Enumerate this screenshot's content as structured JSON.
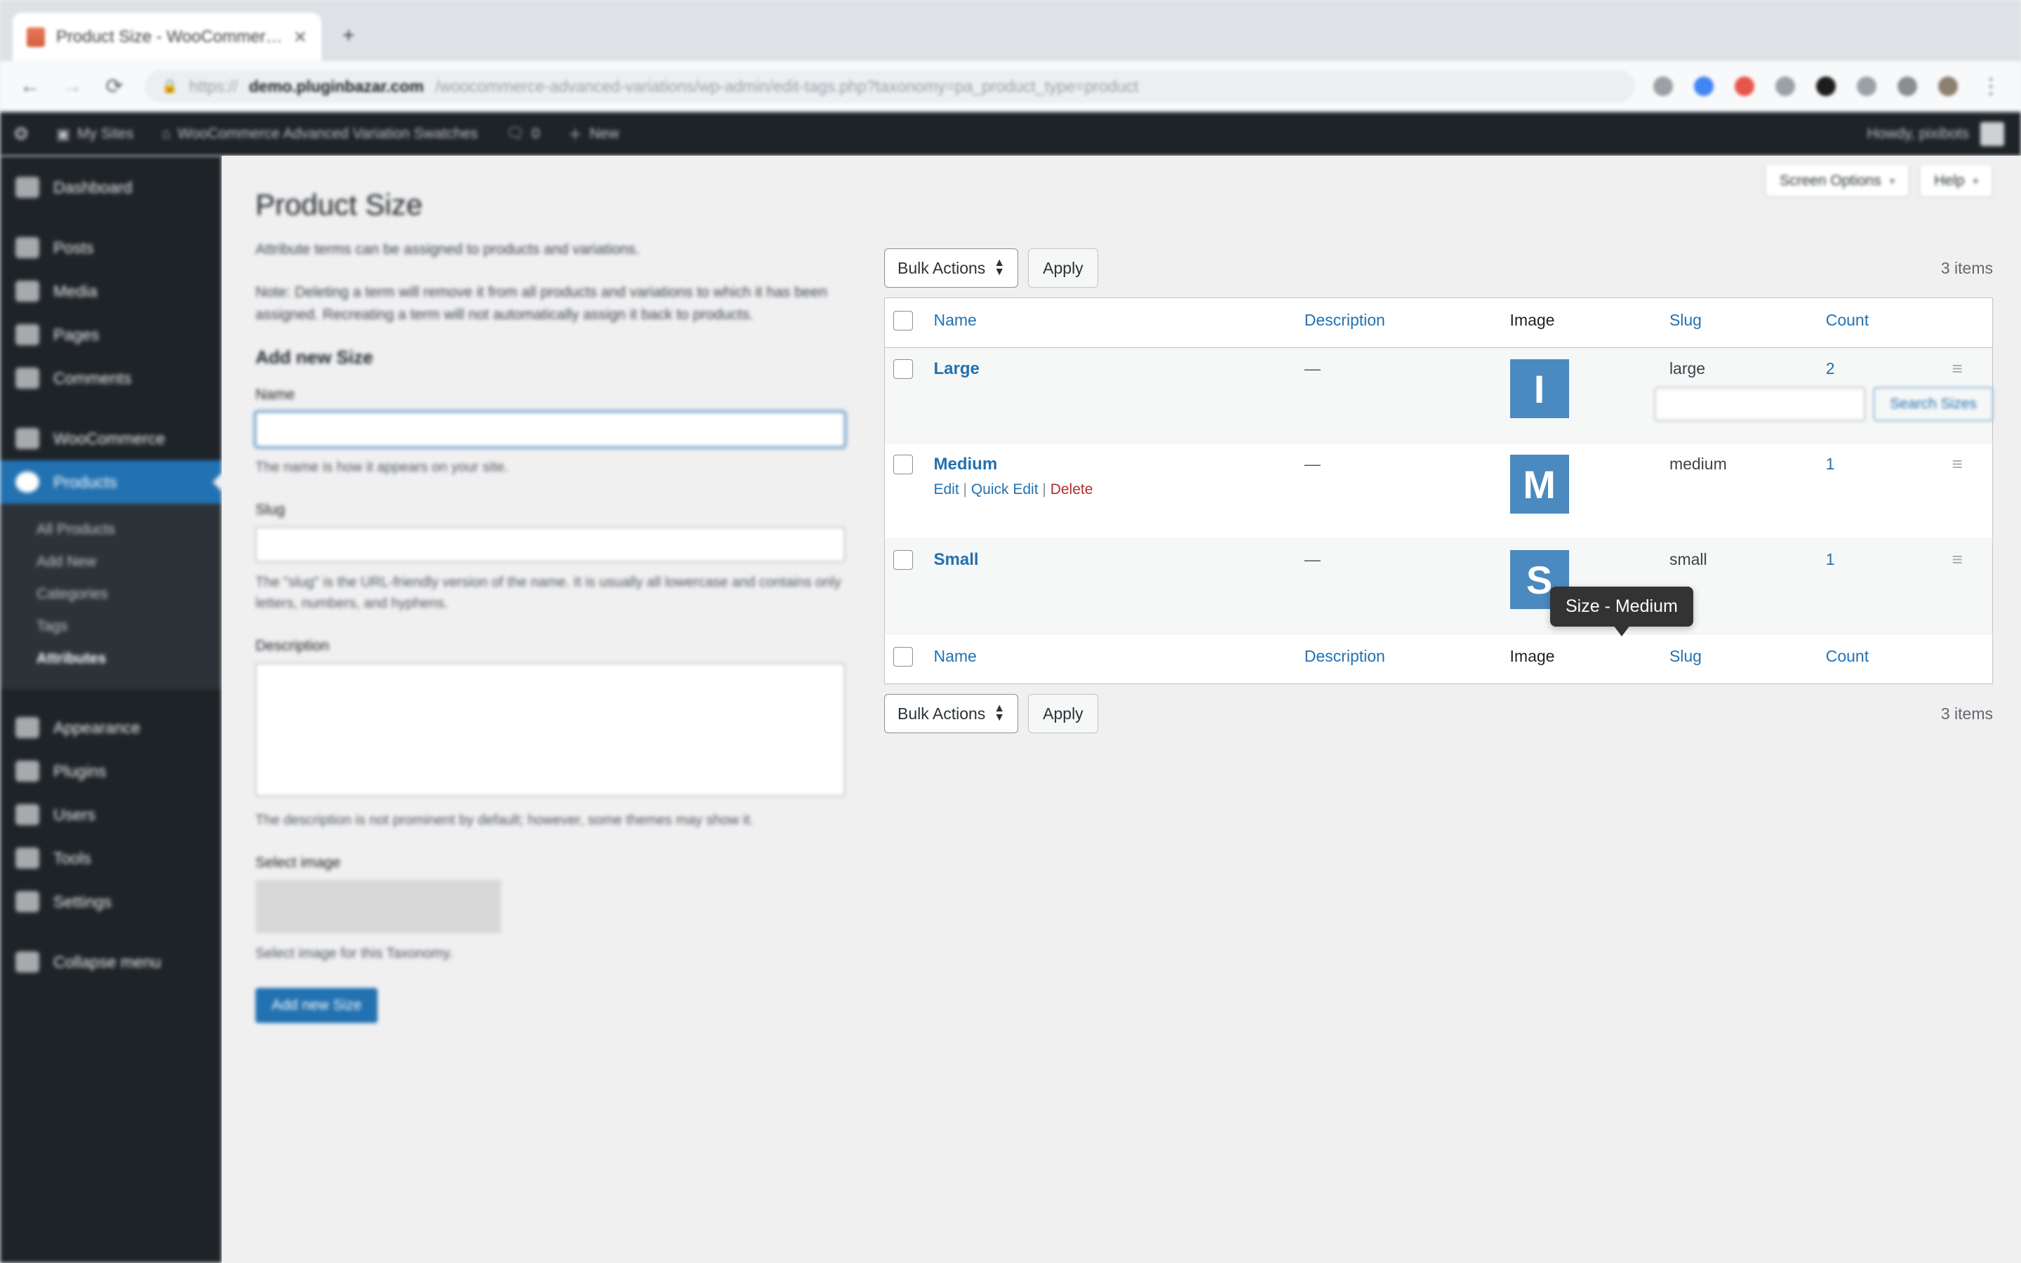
{
  "browser": {
    "tab": {
      "title": "Product Size - WooCommer…",
      "close": "✕",
      "favicon": "wordpress-favicon"
    },
    "new_tab": "+",
    "nav": {
      "back": "←",
      "forward": "→",
      "reload": "⟳"
    },
    "url": {
      "lock": "🔒",
      "scheme": "https://",
      "host": "demo.pluginbazar.com",
      "path": "/woocommerce-advanced-variations/wp-admin/edit-tags.php?taxonomy=pa_product_type=product"
    },
    "extensions": [
      "ext-gray",
      "ext-blue",
      "ext-red",
      "ext-gray2",
      "ext-dark",
      "ext-gray3",
      "ext-gray4",
      "ext-avatar"
    ],
    "menu": "⋮"
  },
  "adminbar": {
    "logo": "wordpress-logo",
    "my_sites": "My Sites",
    "site_name": "WooCommerce Advanced Variation Swatches",
    "comments_count": "0",
    "new": "New",
    "howdy": "Howdy, pixibots"
  },
  "sidebar": {
    "items": [
      {
        "label": "Dashboard",
        "icon": "dashboard-icon",
        "sep": false
      },
      {
        "label": "Posts",
        "icon": "posts-icon",
        "sep": true
      },
      {
        "label": "Media",
        "icon": "media-icon",
        "sep": false
      },
      {
        "label": "Pages",
        "icon": "pages-icon",
        "sep": false
      },
      {
        "label": "Comments",
        "icon": "comments-icon",
        "sep": false
      },
      {
        "label": "WooCommerce",
        "icon": "woocommerce-icon",
        "sep": true
      },
      {
        "label": "Products",
        "icon": "products-icon",
        "sep": false,
        "current": true
      }
    ],
    "submenu": [
      {
        "label": "All Products",
        "current": false
      },
      {
        "label": "Add New",
        "current": false
      },
      {
        "label": "Categories",
        "current": false
      },
      {
        "label": "Tags",
        "current": false
      },
      {
        "label": "Attributes",
        "current": true
      }
    ],
    "items_after": [
      {
        "label": "Appearance",
        "icon": "appearance-icon",
        "sep": true
      },
      {
        "label": "Plugins",
        "icon": "plugins-icon",
        "sep": false
      },
      {
        "label": "Users",
        "icon": "users-icon",
        "sep": false
      },
      {
        "label": "Tools",
        "icon": "tools-icon",
        "sep": false
      },
      {
        "label": "Settings",
        "icon": "settings-icon",
        "sep": false
      },
      {
        "label": "Collapse menu",
        "icon": "collapse-icon",
        "sep": true
      }
    ]
  },
  "screen_meta": {
    "screen_options": "Screen Options",
    "help": "Help",
    "caret": "▾"
  },
  "page": {
    "title": "Product Size"
  },
  "search": {
    "value": "",
    "button": "Search Sizes"
  },
  "form": {
    "intro": "Attribute terms can be assigned to products and variations.",
    "note": "Note: Deleting a term will remove it from all products and variations to which it has been assigned. Recreating a term will not automatically assign it back to products.",
    "heading": "Add new Size",
    "name_label": "Name",
    "name_value": "",
    "name_help": "The name is how it appears on your site.",
    "slug_label": "Slug",
    "slug_value": "",
    "slug_help": "The \"slug\" is the URL-friendly version of the name. It is usually all lowercase and contains only letters, numbers, and hyphens.",
    "description_label": "Description",
    "description_value": "",
    "description_help": "The description is not prominent by default; however, some themes may show it.",
    "image_label": "Select image",
    "image_help": "Select image for this Taxonomy.",
    "submit": "Add new Size"
  },
  "table": {
    "bulk_actions_label": "Bulk Actions",
    "apply_label": "Apply",
    "items_count": "3 items",
    "columns": {
      "name": "Name",
      "description": "Description",
      "image": "Image",
      "slug": "Slug",
      "count": "Count"
    },
    "rows": [
      {
        "name": "Large",
        "description": "—",
        "image_letter": "I",
        "image_color": "#4a8ac0",
        "slug": "large",
        "count": "2",
        "handle": "≡"
      },
      {
        "name": "Medium",
        "description": "—",
        "image_letter": "M",
        "image_color": "#4a8ac0",
        "slug": "medium",
        "count": "1",
        "handle": "≡",
        "actions": {
          "edit": "Edit",
          "quick_edit": "Quick Edit",
          "delete": "Delete",
          "sep": "|"
        }
      },
      {
        "name": "Small",
        "description": "—",
        "image_letter": "S",
        "image_color": "#4a8ac0",
        "slug": "small",
        "count": "1",
        "handle": "≡"
      }
    ]
  },
  "tooltip": {
    "text": "Size - Medium"
  },
  "colors": {
    "accent": "#2271b1",
    "swatch": "#4a8ac0",
    "delete": "#b32d2e",
    "adminbar": "#1d2327"
  }
}
